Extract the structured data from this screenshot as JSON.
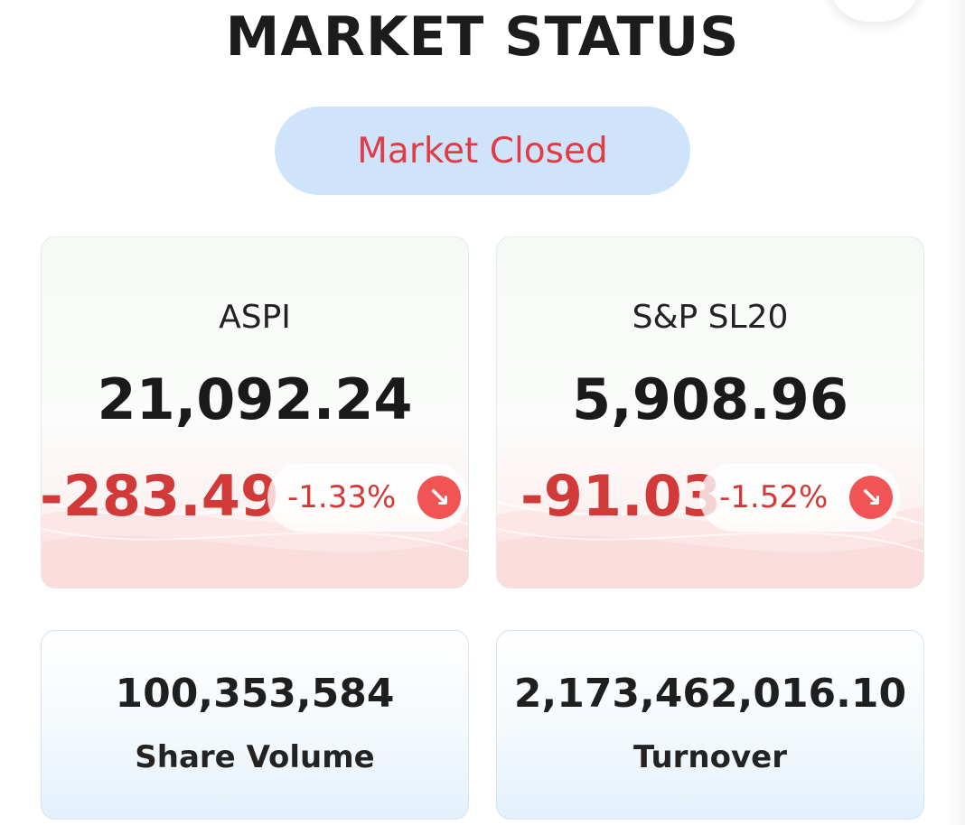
{
  "header": {
    "title": "MARKET STATUS"
  },
  "status": {
    "label": "Market Closed",
    "text_color": "#e13b46",
    "pill_color": "#cfe4fb"
  },
  "indices": [
    {
      "name": "ASPI",
      "value": "21,092.24",
      "change": "-283.49",
      "change_percent": "-1.33%",
      "direction_icon": "arrow-down-right-icon"
    },
    {
      "name": "S&P SL20",
      "value": "5,908.96",
      "change": "-91.03",
      "change_percent": "-1.52%",
      "direction_icon": "arrow-down-right-icon"
    }
  ],
  "stats": [
    {
      "value": "100,353,584",
      "label": "Share Volume"
    },
    {
      "value": "2,173,462,016.10",
      "label": "Turnover"
    }
  ],
  "colors": {
    "negative": "#d23a3a",
    "negative_icon_bg": "#f05454"
  }
}
